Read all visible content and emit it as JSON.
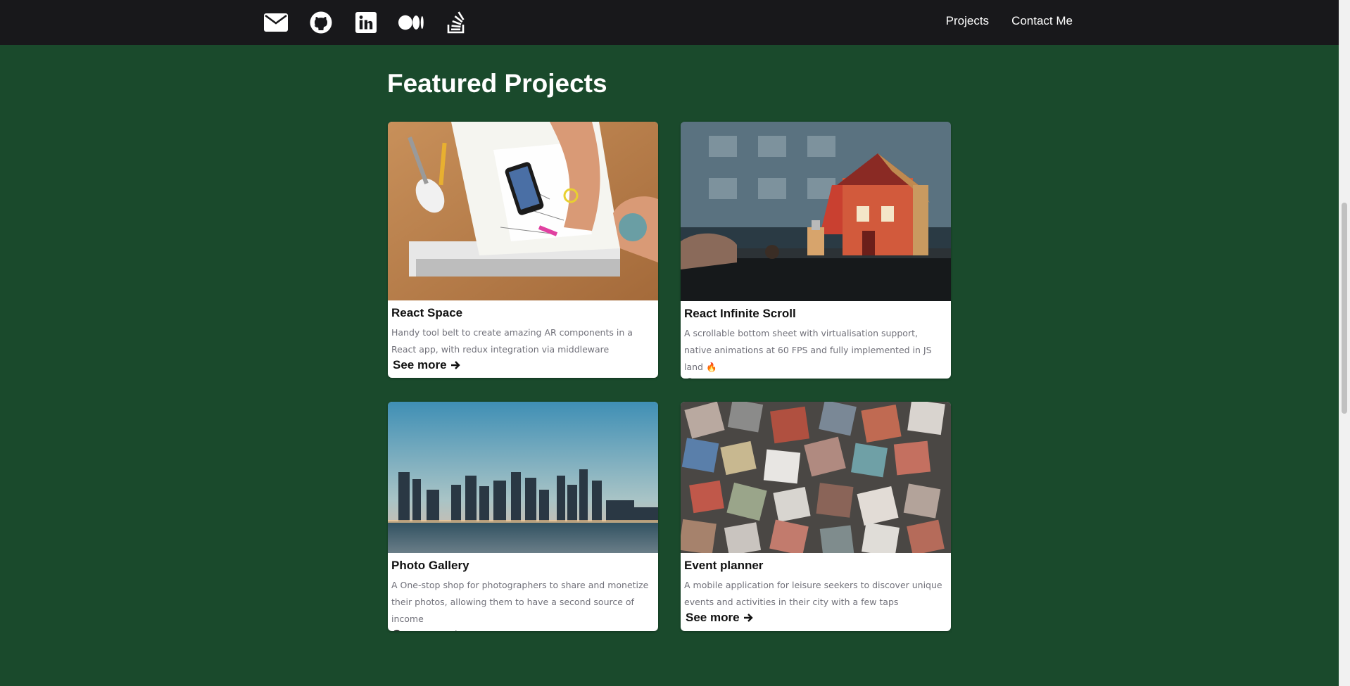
{
  "nav": {
    "social": [
      {
        "icon": "envelope-icon",
        "name": "email"
      },
      {
        "icon": "github-icon",
        "name": "github"
      },
      {
        "icon": "linkedin-icon",
        "name": "linkedin"
      },
      {
        "icon": "medium-icon",
        "name": "medium"
      },
      {
        "icon": "stackoverflow-icon",
        "name": "stackoverflow"
      }
    ],
    "links": [
      "Projects",
      "Contact Me"
    ]
  },
  "main": {
    "heading": "Featured Projects",
    "see_more_label": "See more",
    "projects": [
      {
        "title": "React Space",
        "description": "Handy tool belt to create amazing AR components in a React app, with redux integration via middleware",
        "image": "desk-workspace-photo"
      },
      {
        "title": "React Infinite Scroll",
        "description": "A scrollable bottom sheet with virtualisation support, native animations at 60 FPS and fully implemented in JS land 🔥",
        "image": "toy-house-photo"
      },
      {
        "title": "Photo Gallery",
        "description": "A One-stop shop for photographers to share and monetize their photos, allowing them to have a second source of income",
        "image": "city-skyline-photo"
      },
      {
        "title": "Event planner",
        "description": "A mobile application for leisure seekers to discover unique events and activities in their city with a few taps",
        "image": "colorful-cubes-photo"
      }
    ]
  },
  "colors": {
    "page_background": "#1a4a2c",
    "navbar": "#18181b",
    "card": "#ffffff",
    "description_text": "#71717a"
  }
}
